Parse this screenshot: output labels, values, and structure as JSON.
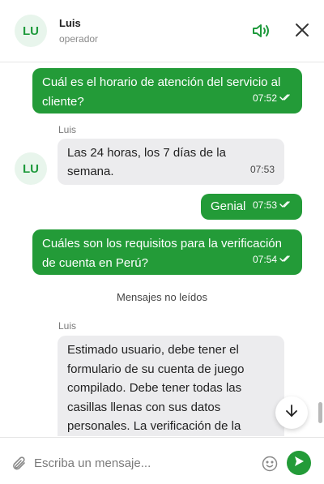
{
  "header": {
    "avatar_initials": "LU",
    "name": "Luis",
    "role": "operador",
    "icons": {
      "sound": "speaker-icon",
      "close": "close-icon"
    }
  },
  "messages": [
    {
      "direction": "out",
      "text": "Cuál es el horario de atención del servicio al cliente?",
      "time": "07:52",
      "status": "read"
    },
    {
      "direction": "in",
      "sender": "Luis",
      "avatar_initials": "LU",
      "text": "Las 24 horas, los 7 días de la semana.",
      "time": "07:53"
    },
    {
      "direction": "out",
      "text": "Genial",
      "time": "07:53",
      "status": "read"
    },
    {
      "direction": "out",
      "text": "Cuáles son los requisitos para la verificación de cuenta en Perú?",
      "time": "07:54",
      "status": "read"
    },
    {
      "direction": "in",
      "sender": "Luis",
      "text": "Estimado usuario, debe tener el formulario de su cuenta de juego compilado. Debe tener todas las casillas llenas con sus datos personales. La verificación de la"
    }
  ],
  "unread_divider": "Mensajes no leídos",
  "composer": {
    "placeholder": "Escriba un mensaje...",
    "icons": {
      "attach": "paperclip-icon",
      "emoji": "emoji-icon",
      "send": "send-icon"
    }
  },
  "colors": {
    "accent": "#239b38",
    "incoming_bubble": "#ececee",
    "avatar_bg": "#e8f5ec"
  }
}
